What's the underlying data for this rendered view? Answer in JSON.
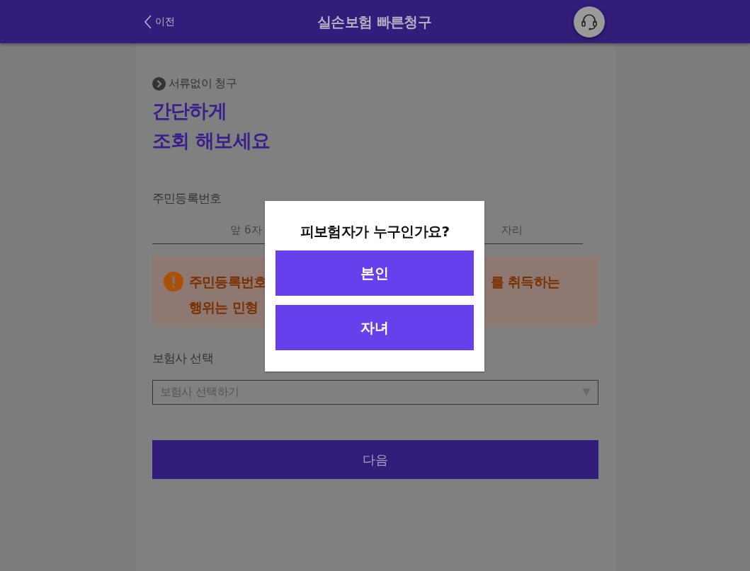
{
  "header": {
    "back_label": "이전",
    "title": "실손보험 빠른청구"
  },
  "intro": {
    "tag": "서류없이 청구",
    "heading_lines": [
      "간단하게",
      "조회 해보세요"
    ]
  },
  "id_number": {
    "label": "주민등록번호",
    "front_placeholder": "앞 6자",
    "back_placeholder": "자리"
  },
  "warning": {
    "line_1_left": "주민등록번호",
    "line_1_right": "를 취득하는",
    "line_2_left": "행위는 민형"
  },
  "insurer": {
    "label": "보험사 선택",
    "placeholder": "보험사 선택하기"
  },
  "next_button": "다음",
  "dialog": {
    "title": "피보험자가 누구인가요?",
    "options": [
      "본인",
      "자녀"
    ]
  }
}
